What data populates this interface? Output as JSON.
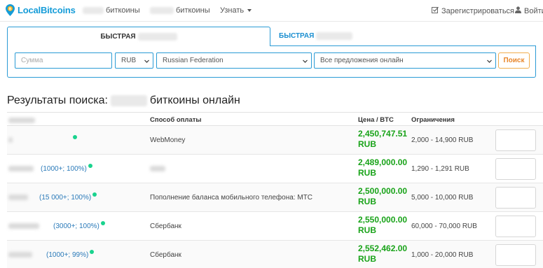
{
  "nav": {
    "logo_text": "LocalBitcoins",
    "link1_label": "биткоины",
    "link2_label": "биткоины",
    "learn_label": "Узнать",
    "register_label": "Зарегистрироваться",
    "login_label": "Войти"
  },
  "search": {
    "tab_quick_buy": "БЫСТРАЯ",
    "tab_quick_sell": "БЫСТРАЯ",
    "amount_placeholder": "Сумма",
    "currency": "RUB",
    "country": "Russian Federation",
    "offers_filter": "Все предложения онлайн",
    "search_button": "Поиск"
  },
  "results": {
    "title_prefix": "Результаты поиска:",
    "title_suffix": "биткоины онлайн",
    "columns": {
      "method": "Способ оплаты",
      "price": "Цена / BTC",
      "limits": "Ограничения"
    },
    "rows": [
      {
        "seller_stats": "",
        "method": "WebMoney",
        "price": "2,450,747.51",
        "currency": "RUB",
        "limits": "2,000 - 14,900 RUB"
      },
      {
        "seller_stats": "(1000+; 100%)",
        "method": "",
        "price": "2,489,000.00",
        "currency": "RUB",
        "limits": "1,290 - 1,291 RUB"
      },
      {
        "seller_stats": "(15 000+; 100%)",
        "method": "Пополнение баланса мобильного телефона: МТС",
        "price": "2,500,000.00",
        "currency": "RUB",
        "limits": "5,000 - 10,000 RUB"
      },
      {
        "seller_stats": "(3000+; 100%)",
        "method": "Сбербанк",
        "price": "2,550,000.00",
        "currency": "RUB",
        "limits": "60,000 - 70,000 RUB"
      },
      {
        "seller_stats": "(1000+; 99%)",
        "method": "Сбербанк",
        "price": "2,552,462.00",
        "currency": "RUB",
        "limits": "1,000 - 20,000 RUB"
      }
    ]
  },
  "colors": {
    "brand_blue": "#159cd8",
    "price_green": "#19a319",
    "online_dot": "#19d38e",
    "search_orange": "#e8862a"
  }
}
